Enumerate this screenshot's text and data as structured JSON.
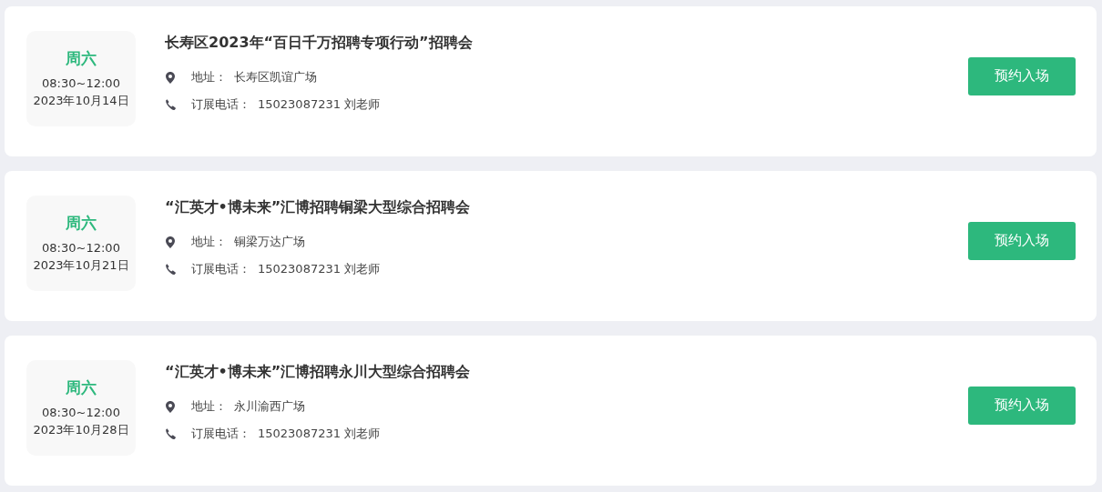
{
  "fairs": [
    {
      "weekday": "周六",
      "time": "08:30~12:00",
      "date": "2023年10月14日",
      "title": "长寿区2023年“百日千万招聘专项行动”招聘会",
      "address_label": "地址：",
      "address": "长寿区凯谊广场",
      "phone_label": "订展电话：",
      "phone": "15023087231 刘老师",
      "button": "预约入场"
    },
    {
      "weekday": "周六",
      "time": "08:30~12:00",
      "date": "2023年10月21日",
      "title": "“汇英才•博未来”汇博招聘铜梁大型综合招聘会",
      "address_label": "地址：",
      "address": "铜梁万达广场",
      "phone_label": "订展电话：",
      "phone": "15023087231 刘老师",
      "button": "预约入场"
    },
    {
      "weekday": "周六",
      "time": "08:30~12:00",
      "date": "2023年10月28日",
      "title": "“汇英才•博未来”汇博招聘永川大型综合招聘会",
      "address_label": "地址：",
      "address": "永川渝西广场",
      "phone_label": "订展电话：",
      "phone": "15023087231 刘老师",
      "button": "预约入场"
    }
  ]
}
